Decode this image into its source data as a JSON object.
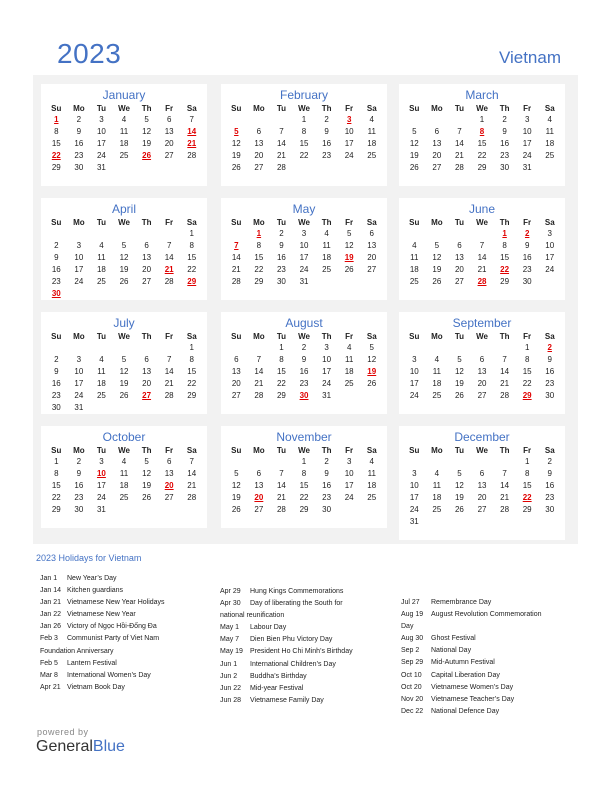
{
  "header": {
    "year": "2023",
    "country": "Vietnam"
  },
  "dow": [
    "Su",
    "Mo",
    "Tu",
    "We",
    "Th",
    "Fr",
    "Sa"
  ],
  "months": [
    {
      "name": "January",
      "start": 0,
      "days": 31,
      "holidays": [
        1,
        14,
        21,
        22,
        26
      ]
    },
    {
      "name": "February",
      "start": 3,
      "days": 28,
      "holidays": [
        3,
        5
      ]
    },
    {
      "name": "March",
      "start": 3,
      "days": 31,
      "holidays": [
        8
      ]
    },
    {
      "name": "April",
      "start": 6,
      "days": 30,
      "holidays": [
        21,
        29,
        30
      ]
    },
    {
      "name": "May",
      "start": 1,
      "days": 31,
      "holidays": [
        1,
        7,
        19
      ]
    },
    {
      "name": "June",
      "start": 4,
      "days": 30,
      "holidays": [
        1,
        2,
        22,
        28
      ]
    },
    {
      "name": "July",
      "start": 6,
      "days": 31,
      "holidays": [
        27
      ]
    },
    {
      "name": "August",
      "start": 2,
      "days": 31,
      "holidays": [
        19,
        30
      ]
    },
    {
      "name": "September",
      "start": 5,
      "days": 30,
      "holidays": [
        2,
        29
      ]
    },
    {
      "name": "October",
      "start": 0,
      "days": 31,
      "holidays": [
        10,
        20
      ]
    },
    {
      "name": "November",
      "start": 3,
      "days": 30,
      "holidays": [
        20
      ]
    },
    {
      "name": "December",
      "start": 5,
      "days": 31,
      "holidays": [
        22
      ]
    }
  ],
  "holidays_title": "2023 Holidays for Vietnam",
  "holiday_columns": [
    [
      {
        "date": "Jan 1",
        "name": "New Year’s Day"
      },
      {
        "date": "Jan 14",
        "name": "Kitchen guardians"
      },
      {
        "date": "Jan 21",
        "name": "Vietnamese New Year Holidays"
      },
      {
        "date": "Jan 22",
        "name": "Vietnamese New Year"
      },
      {
        "date": "Jan 26",
        "name": "Victory of Ngọc Hồi-Đống Đa"
      },
      {
        "date": "Feb 3",
        "name": "Communist Party of Viet Nam",
        "cont": "Foundation Anniversary"
      },
      {
        "date": "Feb 5",
        "name": "Lantern Festival"
      },
      {
        "date": "Mar 8",
        "name": "International Women’s Day"
      },
      {
        "date": "Apr 21",
        "name": "Vietnam Book Day"
      }
    ],
    [
      {
        "date": "Apr 29",
        "name": "Hung Kings Commemorations"
      },
      {
        "date": "Apr 30",
        "name": "Day of liberating the South for",
        "cont": "national reunification"
      },
      {
        "date": "May 1",
        "name": "Labour Day"
      },
      {
        "date": "May 7",
        "name": "Dien Bien Phu Victory Day"
      },
      {
        "date": "May 19",
        "name": "President Ho Chi Minh’s Birthday"
      },
      {
        "date": "Jun 1",
        "name": "International Children’s Day"
      },
      {
        "date": "Jun 2",
        "name": "Buddha’s Birthday"
      },
      {
        "date": "Jun 22",
        "name": "Mid-year Festival"
      },
      {
        "date": "Jun 28",
        "name": "Vietnamese Family Day"
      }
    ],
    [
      {
        "date": "Jul 27",
        "name": "Remembrance Day"
      },
      {
        "date": "Aug 19",
        "name": "August Revolution Commemoration",
        "cont": "Day"
      },
      {
        "date": "Aug 30",
        "name": "Ghost Festival"
      },
      {
        "date": "Sep 2",
        "name": "National Day"
      },
      {
        "date": "Sep 29",
        "name": "Mid-Autumn Festival"
      },
      {
        "date": "Oct 10",
        "name": "Capital Liberation Day"
      },
      {
        "date": "Oct 20",
        "name": "Vietnamese Women’s Day"
      },
      {
        "date": "Nov 20",
        "name": "Vietnamese Teacher’s Day"
      },
      {
        "date": "Dec 22",
        "name": "National Defence Day"
      }
    ]
  ],
  "footer": {
    "powered_by": "powered by",
    "brand_part1": "General",
    "brand_part2": "Blue"
  }
}
